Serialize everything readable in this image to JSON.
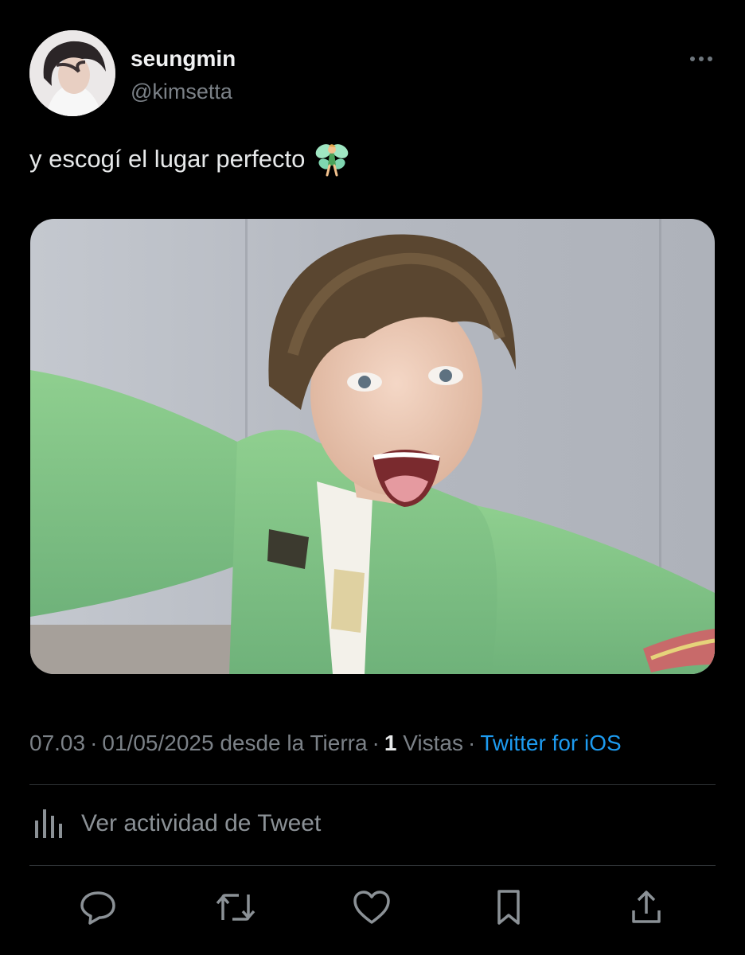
{
  "user": {
    "display_name": "seungmin",
    "handle": "@kimsetta"
  },
  "tweet": {
    "text": "y escogí el lugar perfecto",
    "emoji": "fairy-emoji"
  },
  "meta": {
    "time": "07.03",
    "date": "01/05/2025",
    "location": "desde la Tierra",
    "views_count": "1",
    "views_label": "Vistas",
    "source": "Twitter for iOS",
    "separator": "·"
  },
  "activity": {
    "label": "Ver actividad de Tweet",
    "icon": "analytics-icon"
  },
  "actions": [
    {
      "name": "reply",
      "icon": "speech-bubble-icon"
    },
    {
      "name": "retweet",
      "icon": "retweet-icon"
    },
    {
      "name": "like",
      "icon": "heart-icon"
    },
    {
      "name": "bookmark",
      "icon": "bookmark-icon"
    },
    {
      "name": "share",
      "icon": "share-icon"
    }
  ],
  "colors": {
    "background": "#000000",
    "text_primary": "#e7e9ea",
    "text_secondary": "#7b8187",
    "link": "#1d9bf0",
    "divider": "#2f3336",
    "icon": "#8b9196"
  }
}
